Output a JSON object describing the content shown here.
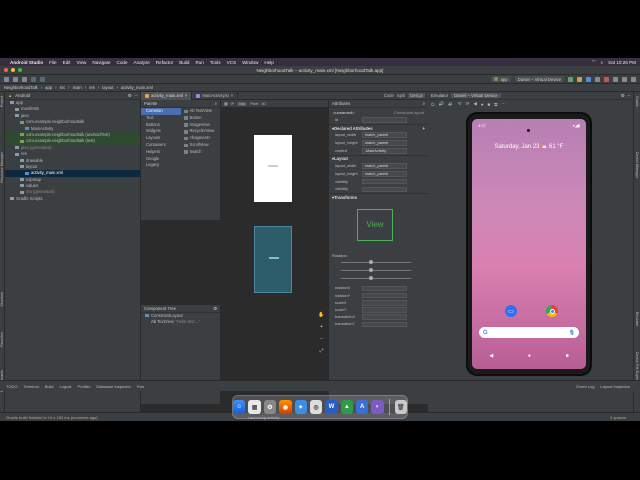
{
  "menubar": {
    "app": "Android Studio",
    "items": [
      "File",
      "Edit",
      "View",
      "Navigate",
      "Code",
      "Analyze",
      "Refactor",
      "Build",
      "Run",
      "Tools",
      "VCS",
      "Window",
      "Help"
    ],
    "clock": "Sat 10:28 PM"
  },
  "window": {
    "title": "NeighborhoodTalk – activity_main.xml [NeighborhoodTalk.app]"
  },
  "toolbar": {
    "module": "app",
    "device": "Daniel – Virtual Device"
  },
  "breadcrumb": [
    "NeighborhoodTalk",
    "app",
    "src",
    "main",
    "res",
    "layout",
    "activity_main.xml"
  ],
  "project": {
    "header": "Android",
    "tree": [
      {
        "label": "app",
        "indent": 1,
        "type": "folder"
      },
      {
        "label": "manifests",
        "indent": 2,
        "type": "folder"
      },
      {
        "label": "java",
        "indent": 2,
        "type": "folder"
      },
      {
        "label": "com.example.neighborhoodtalk",
        "indent": 3,
        "type": "pkg"
      },
      {
        "label": "MainActivity",
        "indent": 4,
        "type": "file"
      },
      {
        "label": "com.example.neighborhoodtalk (androidTest)",
        "indent": 3,
        "type": "pkg",
        "hl": true
      },
      {
        "label": "com.example.neighborhoodtalk (test)",
        "indent": 3,
        "type": "pkg",
        "hl": true
      },
      {
        "label": "java (generated)",
        "indent": 2,
        "type": "folder",
        "dim": true
      },
      {
        "label": "res",
        "indent": 2,
        "type": "folder"
      },
      {
        "label": "drawable",
        "indent": 3,
        "type": "folder"
      },
      {
        "label": "layout",
        "indent": 3,
        "type": "folder"
      },
      {
        "label": "activity_main.xml",
        "indent": 4,
        "type": "file",
        "sel": true
      },
      {
        "label": "mipmap",
        "indent": 3,
        "type": "folder"
      },
      {
        "label": "values",
        "indent": 3,
        "type": "folder"
      },
      {
        "label": "res (generated)",
        "indent": 3,
        "type": "folder",
        "dim": true
      },
      {
        "label": "Gradle Scripts",
        "indent": 1,
        "type": "folder"
      }
    ]
  },
  "editor_tabs": [
    "activity_main.xml",
    "MainActivity.kt"
  ],
  "view_modes": [
    "Code",
    "Split",
    "Design"
  ],
  "palette": {
    "title": "Palette",
    "categories": [
      "Common",
      "Text",
      "Buttons",
      "Widgets",
      "Layouts",
      "Containers",
      "Helpers",
      "Google",
      "Legacy"
    ],
    "items": [
      "Ab TextView",
      "Button",
      "ImageView",
      "RecyclerView",
      "<fragment>",
      "ScrollView",
      "Switch"
    ]
  },
  "component_tree": {
    "title": "Component Tree",
    "root": "ConstraintLayout",
    "child": "TextView",
    "child_text": "\"Hello Wor...\""
  },
  "design_toolbar": {
    "zoom": "Pixel",
    "api": "30",
    "mode": "0dp"
  },
  "attributes": {
    "title": "Attributes",
    "component": "<unnamed>",
    "type": "ConstraintLayout",
    "id_label": "id",
    "declared_title": "Declared Attributes",
    "declared": [
      {
        "k": "layout_width",
        "v": "match_parent"
      },
      {
        "k": "layout_height",
        "v": "match_parent"
      },
      {
        "k": "context",
        "v": ".MainActivity"
      }
    ],
    "layout_title": "Layout",
    "layout": [
      {
        "k": "layout_width",
        "v": "match_parent"
      },
      {
        "k": "layout_height",
        "v": "match_parent"
      },
      {
        "k": "visibility",
        "v": ""
      },
      {
        "k": "visibility",
        "v": ""
      }
    ],
    "transforms_title": "Transforms",
    "view_label": "View",
    "rotation_label": "Rotation",
    "transform_fields": [
      "rotationX",
      "rotationY",
      "scaleX",
      "scaleY",
      "translationX",
      "translationY"
    ]
  },
  "emulator": {
    "title": "Emulator",
    "device_tab": "Daniel – Virtual Device",
    "phone_time": "4:27",
    "date": "Saturday, Jan 23",
    "temp": "61 °F",
    "search_g": "G"
  },
  "right_strip": [
    "Gradle",
    "Device Manager",
    "Emulator",
    "Device File Explorer"
  ],
  "left_strip": [
    "Project",
    "Resource Manager",
    "Structure",
    "Favorites",
    "Build Variants"
  ],
  "statusbar": [
    "TODO",
    "Terminal",
    "Build",
    "Logcat",
    "Profiler",
    "Database Inspector",
    "Run"
  ],
  "statusbar_right": [
    "Event Log",
    "Layout Inspector"
  ],
  "bottom_msg": "Gradle build finished in 10 s 183 ms (moments ago)",
  "bottom_right": "4 spaces",
  "launch_msg": "Launching activity"
}
